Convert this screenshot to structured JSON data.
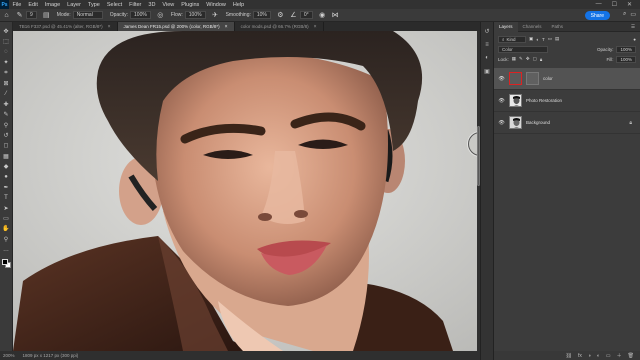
{
  "app": {
    "logo": "Ps",
    "window_controls": [
      "—",
      "☐",
      "✕"
    ]
  },
  "menu": [
    "File",
    "Edit",
    "Image",
    "Layer",
    "Type",
    "Select",
    "Filter",
    "3D",
    "View",
    "Plugins",
    "Window",
    "Help"
  ],
  "options_bar": {
    "mode_label": "Mode:",
    "mode_value": "Normal",
    "opacity_label": "Opacity:",
    "opacity_value": "100%",
    "flow_label": "Flow:",
    "flow_value": "100%",
    "smoothing_label": "Smoothing:",
    "smoothing_value": "10%",
    "angle_value": "0°",
    "size_value": "9",
    "share_label": "Share"
  },
  "tabs": [
    {
      "label": "TB16 F337.psd @ 45.41% (alter, RGB/8*)",
      "active": false
    },
    {
      "label": "James Dean FR15.psd @ 200% (color, RGB/8*)",
      "active": true
    },
    {
      "label": "color mods.psd @ 66.7% (RGB/8)",
      "active": false
    }
  ],
  "status": {
    "zoom": "200%",
    "dimensions": "1809 px x 1217 px (300 ppi)"
  },
  "panel": {
    "tabs": [
      {
        "label": "Layers",
        "active": true
      },
      {
        "label": "Channels",
        "active": false
      },
      {
        "label": "Paths",
        "active": false
      }
    ],
    "filter_label": "Kind",
    "blend_mode": "Color",
    "opacity_label": "Opacity:",
    "opacity_value": "100%",
    "lock_label": "Lock:",
    "fill_label": "Fill:",
    "fill_value": "100%",
    "layers": [
      {
        "name": "color",
        "selected": true,
        "thumb": "mask"
      },
      {
        "name": "Photo Restoration",
        "selected": false,
        "thumb": "photo"
      },
      {
        "name": "Background",
        "selected": false,
        "thumb": "photo",
        "locked": true
      }
    ]
  },
  "colors": {
    "accent": "#1473e6",
    "layer_mask_border": "#dd2222",
    "panel_bg": "#3c3c3c",
    "app_bg": "#282828"
  },
  "icons": {
    "tool_icons": [
      "move-icon",
      "marquee-icon",
      "lasso-icon",
      "magic-wand-icon",
      "crop-icon",
      "frame-icon",
      "eyedropper-icon",
      "healing-brush-icon",
      "brush-icon",
      "clone-stamp-icon",
      "history-brush-icon",
      "eraser-icon",
      "gradient-icon",
      "blur-icon",
      "dodge-icon",
      "pen-icon",
      "type-icon",
      "path-select-icon",
      "rectangle-icon",
      "hand-icon",
      "zoom-icon",
      "more-tools-icon"
    ],
    "tool_glyphs": [
      "✥",
      "⬚",
      "◌",
      "✦",
      "⌗",
      "⊠",
      "⁄",
      "✚",
      "✎",
      "⚲",
      "↺",
      "◻",
      "▦",
      "◆",
      "●",
      "✒",
      "T",
      "➤",
      "▭",
      "✋",
      "⚲",
      "…"
    ]
  }
}
